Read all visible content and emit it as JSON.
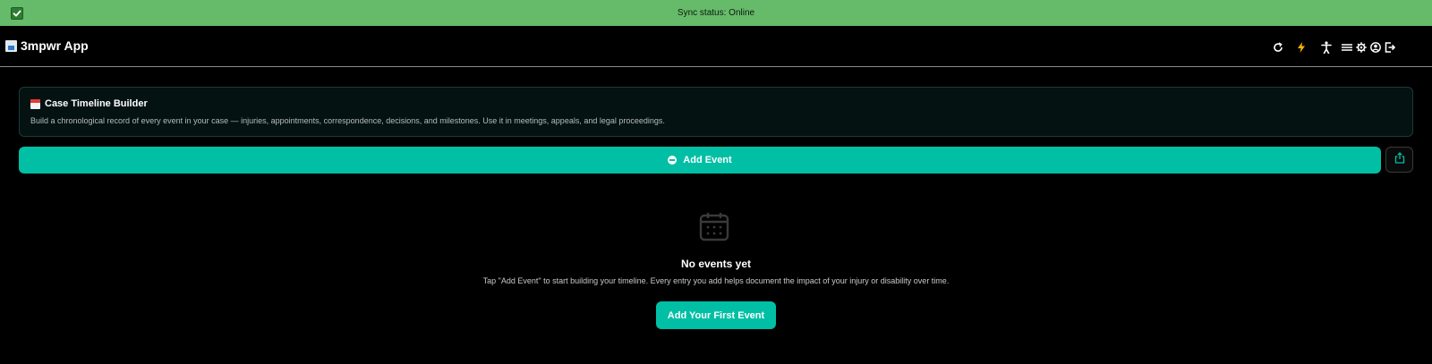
{
  "sync": {
    "text": "Sync status: Online",
    "status_color": "#66bb6a"
  },
  "header": {
    "app_name": "3mpwr App",
    "icons": [
      "refresh-icon",
      "lightning-icon",
      "accessibility-icon",
      "menu-icon",
      "settings-icon",
      "account-icon",
      "logout-icon"
    ]
  },
  "card": {
    "title": "Case Timeline Builder",
    "description": "Build a chronological record of every event in your case — injuries, appointments, correspondence, decisions, and milestones. Use it in meetings, appeals, and legal proceedings."
  },
  "actions": {
    "add_event_label": "Add Event",
    "accent_color": "#00bfa5"
  },
  "empty_state": {
    "title": "No events yet",
    "description": "Tap \"Add Event\" to start building your timeline. Every entry you add helps document the impact of your injury or disability over time.",
    "button_label": "Add Your First Event"
  }
}
